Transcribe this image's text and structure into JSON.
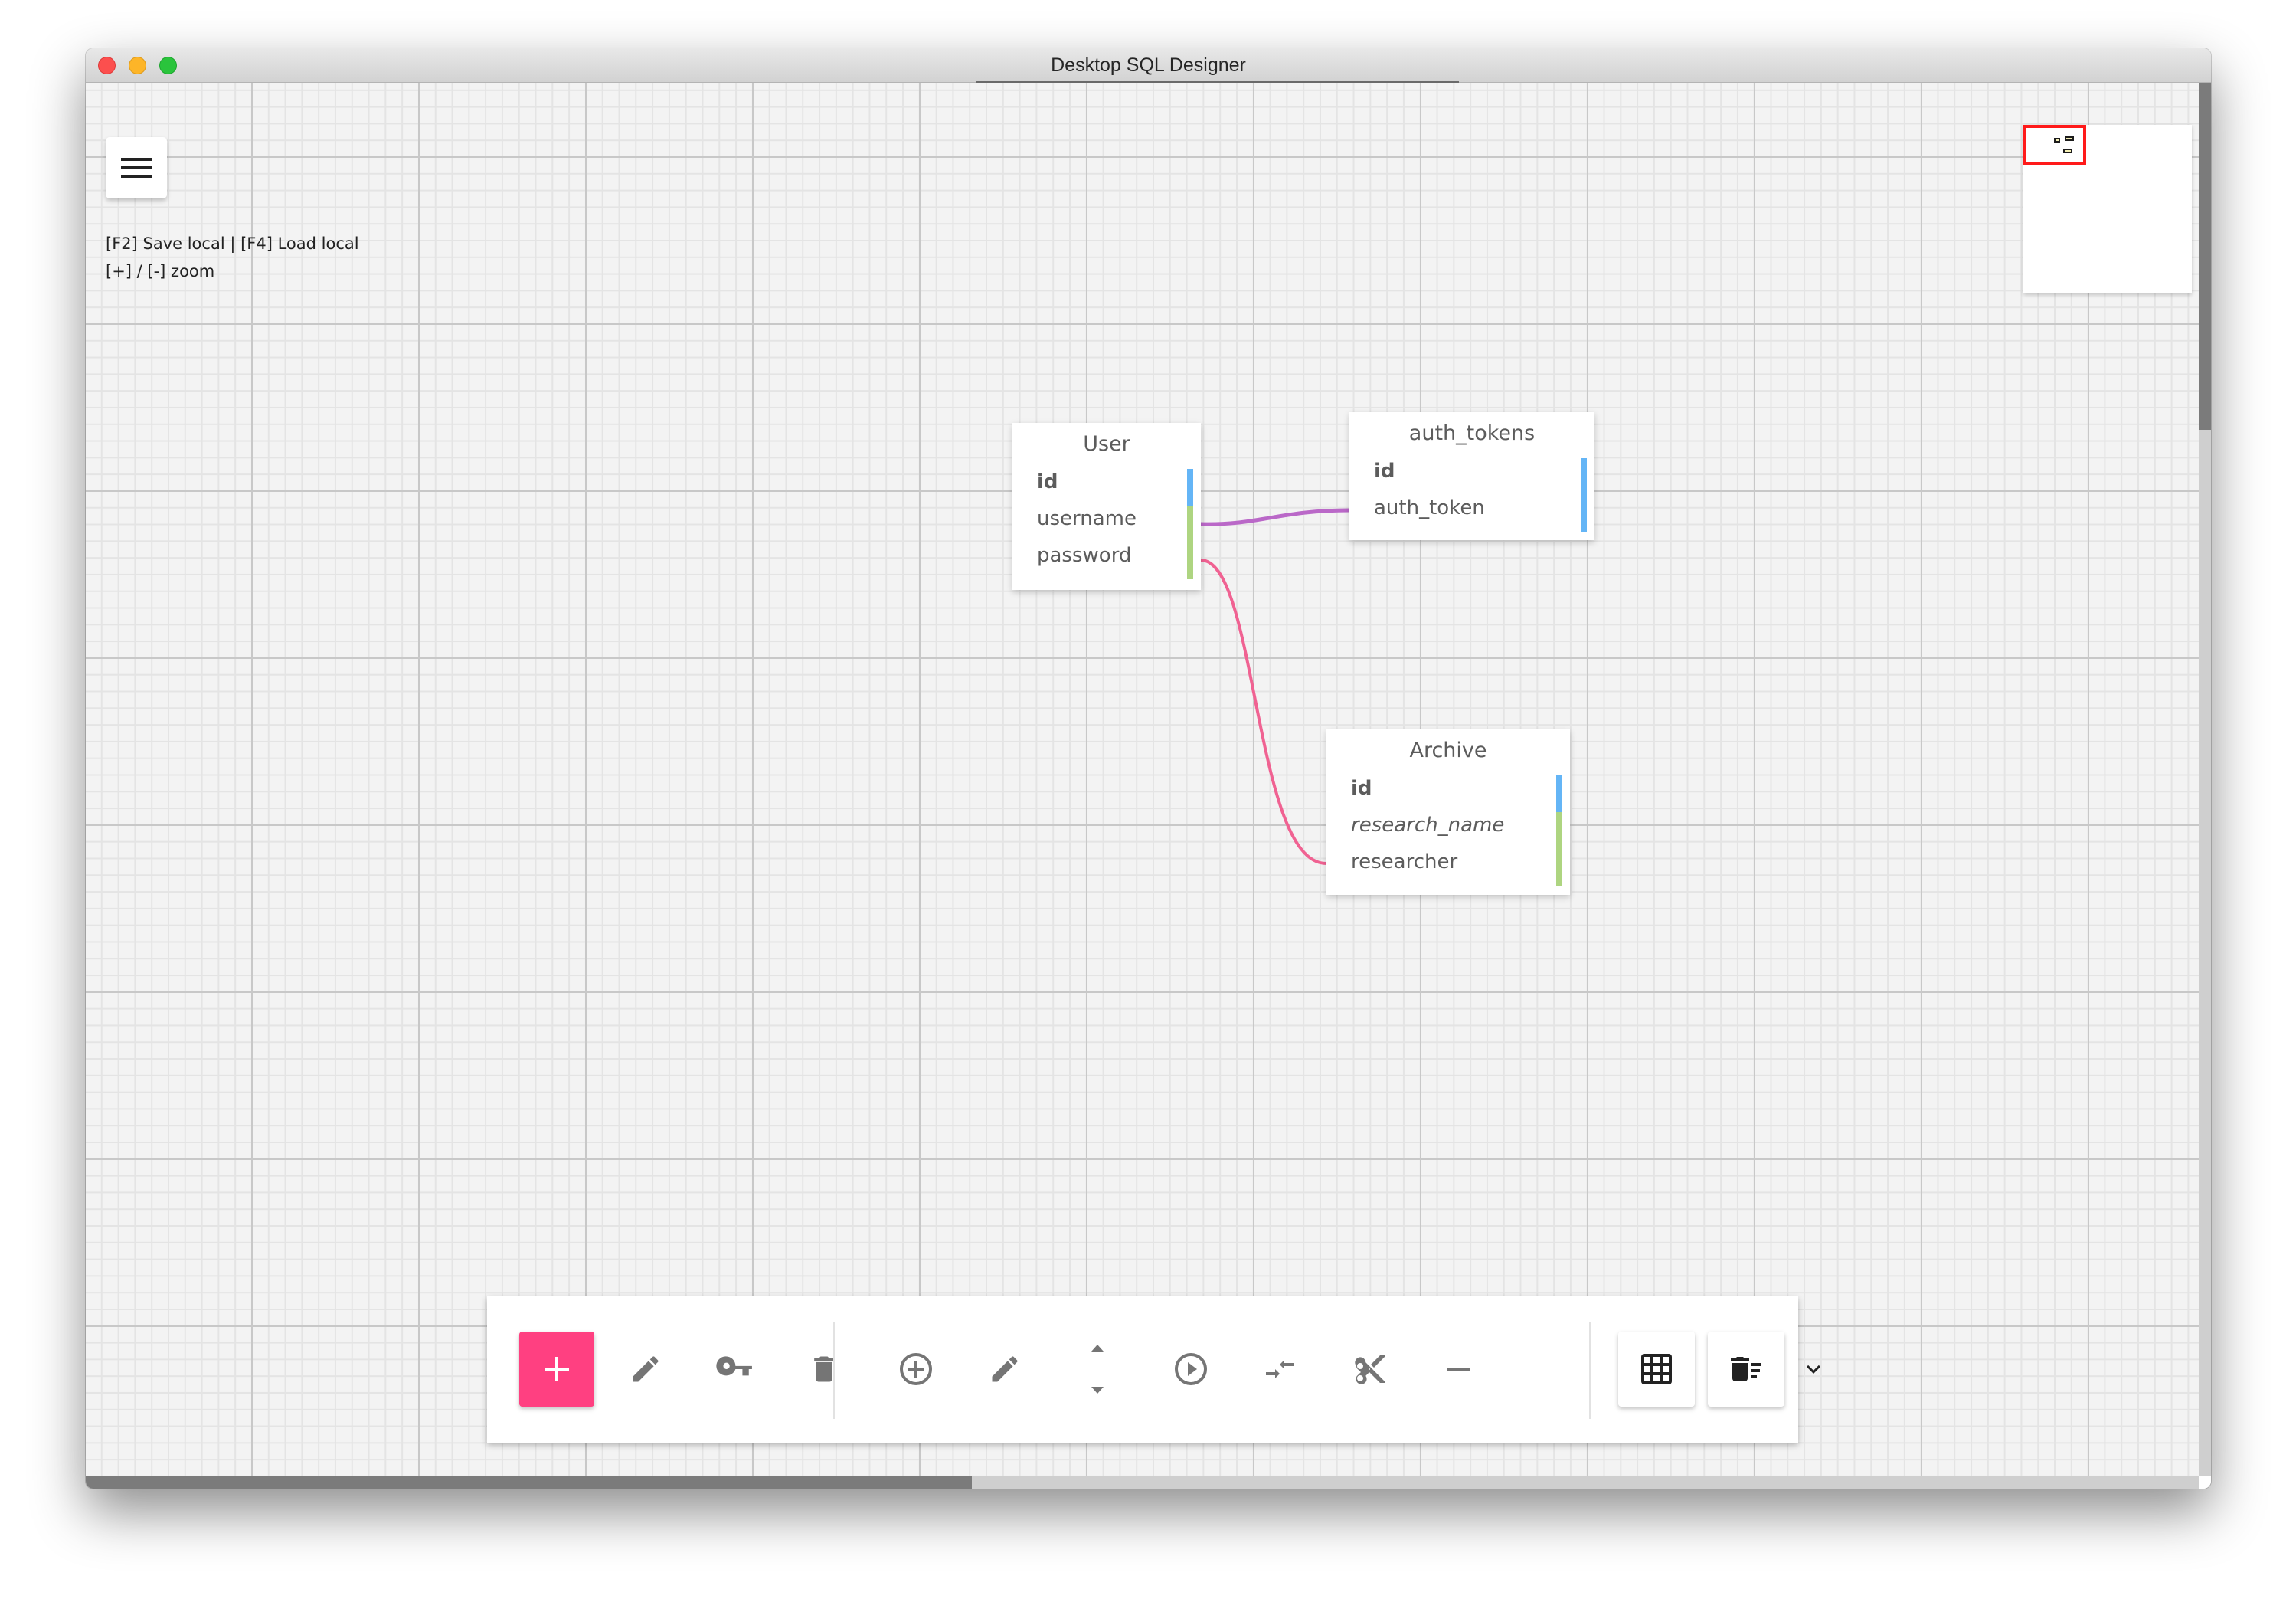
{
  "window": {
    "title": "Desktop SQL Designer"
  },
  "canvas": {
    "menu_button_icon": "hamburger-menu-icon",
    "help_lines": [
      "[F2] Save local | [F4] Load local",
      "[+] / [-] zoom"
    ]
  },
  "tables": [
    {
      "name": "User",
      "fields": [
        {
          "name": "id",
          "style": "primary-key",
          "marker": "blue"
        },
        {
          "name": "username",
          "style": "normal",
          "marker": "green"
        },
        {
          "name": "password",
          "style": "normal",
          "marker": "green"
        }
      ]
    },
    {
      "name": "auth_tokens",
      "fields": [
        {
          "name": "id",
          "style": "primary-key",
          "marker": "blue"
        },
        {
          "name": "auth_token",
          "style": "normal",
          "marker": "blue"
        }
      ]
    },
    {
      "name": "Archive",
      "fields": [
        {
          "name": "id",
          "style": "primary-key",
          "marker": "blue"
        },
        {
          "name": "research_name",
          "style": "italic",
          "marker": "green"
        },
        {
          "name": "researcher",
          "style": "normal",
          "marker": "green"
        }
      ]
    }
  ],
  "relations": [
    {
      "from": "User.id",
      "to": "auth_tokens.id",
      "color": "#ba68c8"
    },
    {
      "from": "User.username",
      "to": "Archive.research_name",
      "color": "#f06292"
    }
  ],
  "toolbar": {
    "buttons": [
      {
        "icon": "add-table-icon",
        "tooltip": "Add table"
      },
      {
        "icon": "edit-table-icon",
        "tooltip": "Edit table"
      },
      {
        "icon": "key-icon",
        "tooltip": "Keys"
      },
      {
        "icon": "delete-table-icon",
        "tooltip": "Delete table"
      },
      {
        "icon": "add-field-icon",
        "tooltip": "Add field"
      },
      {
        "icon": "edit-field-icon",
        "tooltip": "Edit field"
      },
      {
        "icon": "move-field-icon",
        "tooltip": "Move field up / down"
      },
      {
        "icon": "connect-icon",
        "tooltip": "Connect"
      },
      {
        "icon": "merge-icon",
        "tooltip": "Merge"
      },
      {
        "icon": "disconnect-icon",
        "tooltip": "Disconnect"
      },
      {
        "icon": "remove-field-icon",
        "tooltip": "Remove field"
      },
      {
        "icon": "grid-icon",
        "tooltip": "Grid"
      },
      {
        "icon": "clear-all-icon",
        "tooltip": "Clear"
      },
      {
        "icon": "chevron-down-icon",
        "tooltip": "More"
      }
    ]
  },
  "colors": {
    "accent": "#ff4081",
    "primary_key_marker": "#64b5f6",
    "field_marker": "#aed581",
    "minimap_viewport": "#ff1a1a"
  }
}
